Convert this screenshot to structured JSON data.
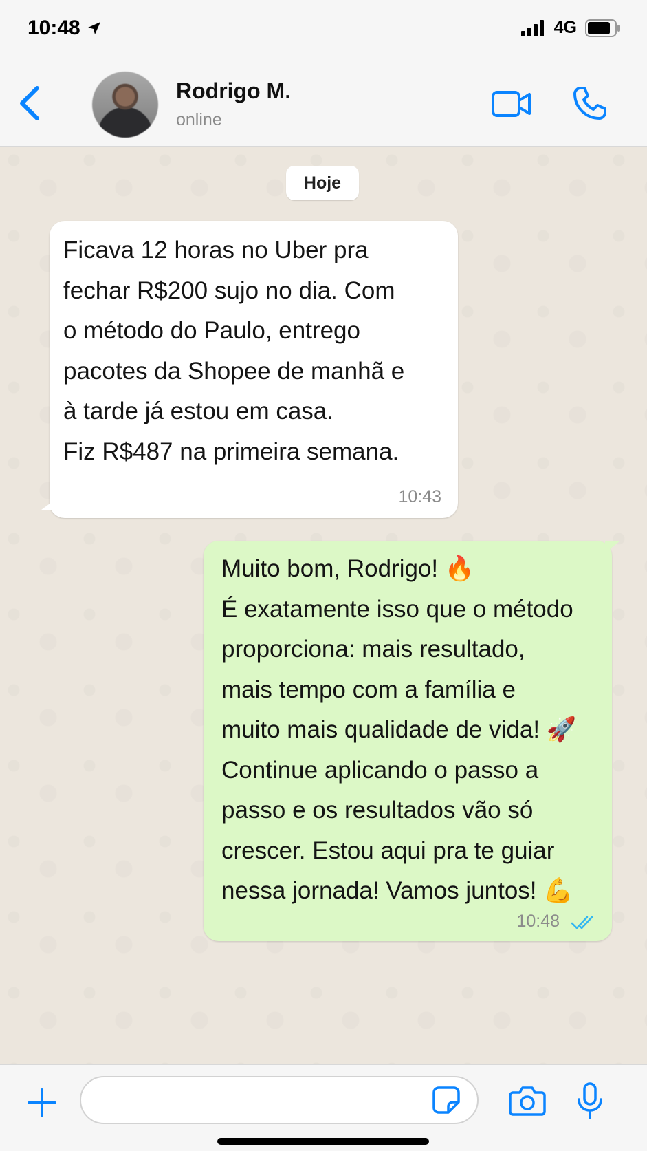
{
  "status_bar": {
    "time": "10:48",
    "network": "4G"
  },
  "header": {
    "contact_name": "Rodrigo M.",
    "contact_status": "online"
  },
  "chat": {
    "date_chip": "Hoje",
    "messages": [
      {
        "direction": "incoming",
        "text": "Ficava 12 horas no Uber pra\nfechar R$200 sujo no dia. Com\no método do Paulo, entrego\npacotes da Shopee de manhã e\nà tarde já estou em casa.\nFiz R$487 na primeira semana.",
        "time": "10:43"
      },
      {
        "direction": "outgoing",
        "text": "Muito bom, Rodrigo! 🔥\nÉ exatamente isso que o método\nproporciona: mais resultado,\nmais tempo com a família e\nmuito mais qualidade de vida! 🚀\nContinue aplicando o passo a\npasso e os resultados vão só\ncrescer. Estou aqui pra te guiar\nnessa jornada! Vamos juntos! 💪",
        "time": "10:48",
        "read": true
      }
    ]
  },
  "input": {
    "placeholder": ""
  },
  "colors": {
    "accent": "#0a84ff",
    "outgoing_bubble": "#dcf8c6",
    "read_ticks": "#34b7f1"
  }
}
